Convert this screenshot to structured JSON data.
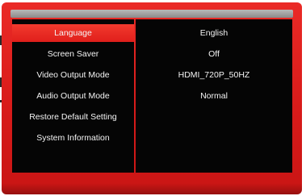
{
  "settings_menu": {
    "items": [
      {
        "label": "Language",
        "selected": true
      },
      {
        "label": "Screen Saver",
        "selected": false
      },
      {
        "label": "Video Output Mode",
        "selected": false
      },
      {
        "label": "Audio Output Mode",
        "selected": false
      },
      {
        "label": "Restore Default Setting",
        "selected": false
      },
      {
        "label": "System Information",
        "selected": false
      }
    ]
  },
  "setting_values": [
    {
      "value": "English"
    },
    {
      "value": "Off"
    },
    {
      "value": "HDMI_720P_50HZ"
    },
    {
      "value": "Normal"
    }
  ],
  "colors": {
    "bezel": "#d81b1a",
    "panel": "#050505",
    "highlight": "#e8231f",
    "text": "#f4f4f4",
    "top_bar": "#9e9e9e"
  }
}
